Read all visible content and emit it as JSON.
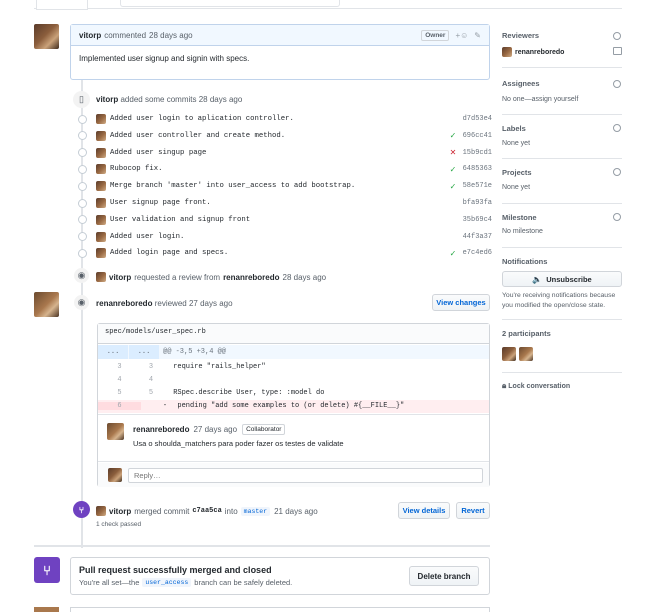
{
  "comment": {
    "author": "vitorp",
    "action": "commented",
    "time": "28 days ago",
    "badge": "Owner",
    "body": "Implemented user signup and signin with specs."
  },
  "commits_event": {
    "author": "vitorp",
    "text": "added some commits",
    "time": "28 days ago"
  },
  "commits": [
    {
      "message": "Added user login to aplication controller.",
      "status": "",
      "sha": "d7d53e4"
    },
    {
      "message": "Added user controller and create method.",
      "status": "success",
      "sha": "696cc41"
    },
    {
      "message": "Added user singup page",
      "status": "failure",
      "sha": "15b9cd1"
    },
    {
      "message": "Rubocop fix.",
      "status": "success",
      "sha": "6485363"
    },
    {
      "message": "Merge branch 'master' into user_access to add bootstrap.",
      "status": "success",
      "sha": "58e571e"
    },
    {
      "message": "User signup page front.",
      "status": "",
      "sha": "bfa93fa"
    },
    {
      "message": "User validation and signup front",
      "status": "",
      "sha": "35b69c4"
    },
    {
      "message": "Added user login.",
      "status": "",
      "sha": "44f3a37"
    },
    {
      "message": "Added login page and specs.",
      "status": "success",
      "sha": "e7c4ed6"
    }
  ],
  "review_request": {
    "author": "vitorp",
    "text": "requested a review from",
    "reviewer": "renanreboredo",
    "time": "28 days ago"
  },
  "review": {
    "author": "renanreboredo",
    "text": "reviewed",
    "time": "27 days ago",
    "view_changes": "View changes",
    "file": "spec/models/user_spec.rb",
    "hunk_left": "...",
    "hunk_right": "...",
    "hunk": "@@ -3,5 +3,4 @@",
    "lines": [
      {
        "old": "3",
        "new": "3",
        "prefix": "",
        "code": " require \"rails_helper\"",
        "type": "context"
      },
      {
        "old": "4",
        "new": "4",
        "prefix": "",
        "code": "",
        "type": "context"
      },
      {
        "old": "5",
        "new": "5",
        "prefix": "",
        "code": " RSpec.describe User, type: :model do",
        "type": "context"
      },
      {
        "old": "6",
        "new": "",
        "prefix": "-",
        "code": "  pending \"add some examples to (or delete) #{__FILE__}\"",
        "type": "deletion"
      }
    ],
    "reply_author": "renanreboredo",
    "reply_time": "27 days ago",
    "reply_badge": "Collaborator",
    "reply_body": "Usa o shoulda_matchers para poder fazer os testes de validate",
    "reply_placeholder": "Reply…"
  },
  "merge_event": {
    "author": "vitorp",
    "text": "merged commit",
    "commit": "c7aa5ca",
    "into": "into",
    "branch": "master",
    "time": "21 days ago",
    "view_details": "View details",
    "revert": "Revert",
    "checks": "1 check passed"
  },
  "merged_box": {
    "title": "Pull request successfully merged and closed",
    "text_before": "You're all set—the",
    "branch": "user_access",
    "text_after": "branch can be safely deleted.",
    "delete_button": "Delete branch"
  },
  "sidebar": {
    "reviewers_label": "Reviewers",
    "reviewer": "renanreboredo",
    "assignees_label": "Assignees",
    "assignees_value": "No one—assign yourself",
    "labels_label": "Labels",
    "labels_value": "None yet",
    "projects_label": "Projects",
    "projects_value": "None yet",
    "milestone_label": "Milestone",
    "milestone_value": "No milestone",
    "notifications_label": "Notifications",
    "unsubscribe": "Unsubscribe",
    "notifications_text": "You're receiving notifications because you modified the open/close state.",
    "participants_label": "2 participants",
    "lock": "Lock conversation"
  },
  "colors": {
    "link": "#0366d6",
    "success": "#28a745",
    "failure": "#cb2431",
    "merged": "#6f42c1",
    "comment_header": "#f1f8ff"
  }
}
